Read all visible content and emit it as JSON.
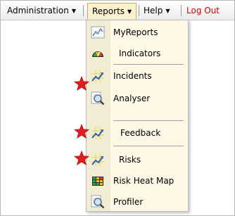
{
  "menubar": {
    "admin": "Administration",
    "reports": "Reports",
    "help": "Help",
    "logout": "Log Out",
    "arrow": "▼",
    "colors": {
      "logout": "#d40000",
      "active_bg": "#fbf0cf"
    }
  },
  "reports_menu": {
    "items": [
      {
        "label": "MyReports",
        "icon": "chart-icon"
      },
      {
        "label": "Indicators",
        "icon": "gauge-icon"
      },
      {
        "label": "Incidents",
        "icon": "trend-icon",
        "starred": true
      },
      {
        "label": "Analyser",
        "icon": "magnifier-icon"
      },
      {
        "label": "Feedback",
        "icon": "trend-icon",
        "starred": true
      },
      {
        "label": "Risks",
        "icon": "trend-icon",
        "starred": true
      },
      {
        "label": "Risk Heat Map",
        "icon": "heatmap-icon"
      },
      {
        "label": "Profiler",
        "icon": "magnifier-icon"
      }
    ]
  },
  "annotation": {
    "star_icon": "red-star-icon",
    "color": "#e01e1e"
  }
}
